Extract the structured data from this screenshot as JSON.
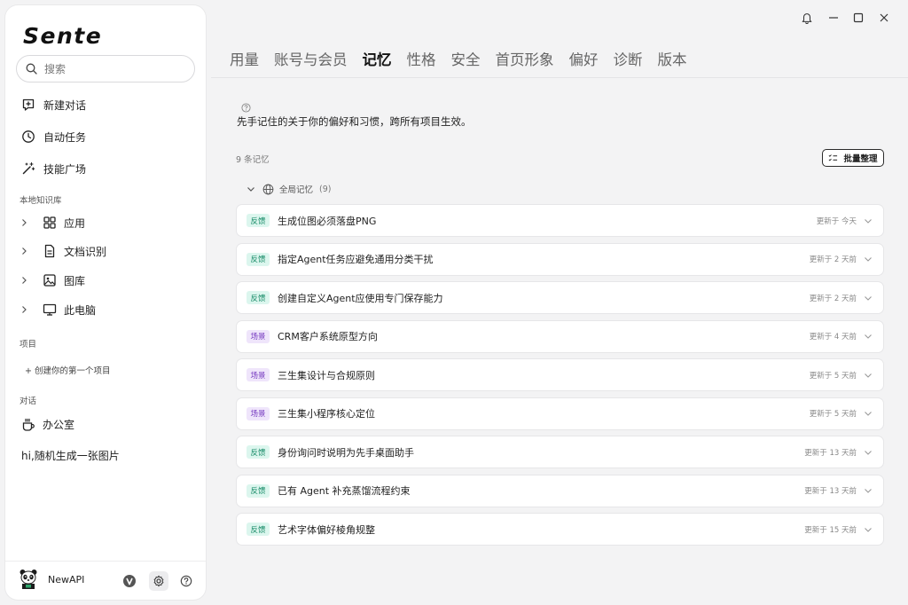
{
  "app": {
    "logo": "Sente"
  },
  "search": {
    "placeholder": "搜索"
  },
  "nav": [
    {
      "label": "新建对话",
      "icon": "new-chat-icon"
    },
    {
      "label": "自动任务",
      "icon": "clock-icon"
    },
    {
      "label": "技能广场",
      "icon": "magic-wand-icon"
    }
  ],
  "knowledge": {
    "label": "本地知识库",
    "items": [
      {
        "label": "应用",
        "icon": "apps-grid-icon"
      },
      {
        "label": "文档识别",
        "icon": "document-icon"
      },
      {
        "label": "图库",
        "icon": "image-icon"
      },
      {
        "label": "此电脑",
        "icon": "monitor-icon"
      }
    ]
  },
  "projects": {
    "label": "项目",
    "create": "+ 创建你的第一个项目"
  },
  "conversations": {
    "label": "对话",
    "items": [
      {
        "label": "办公室",
        "icon": "coffee-icon"
      },
      {
        "label": "hi,随机生成一张图片"
      }
    ]
  },
  "user": {
    "name": "NewAPI"
  },
  "tabs": [
    {
      "label": "用量",
      "active": false
    },
    {
      "label": "账号与会员",
      "active": false
    },
    {
      "label": "记忆",
      "active": true
    },
    {
      "label": "性格",
      "active": false
    },
    {
      "label": "安全",
      "active": false
    },
    {
      "label": "首页形象",
      "active": false
    },
    {
      "label": "偏好",
      "active": false
    },
    {
      "label": "诊断",
      "active": false
    },
    {
      "label": "版本",
      "active": false
    }
  ],
  "memory": {
    "description": "先手记住的关于你的偏好和习惯，跨所有项目生效。",
    "count_label": "9 条记忆",
    "batch_button": "批量整理",
    "group": {
      "label": "全局记忆",
      "count": "(9)"
    },
    "items": [
      {
        "tag": "反馈",
        "kind": "feedback",
        "title": "生成位图必须落盘PNG",
        "updated": "更新于 今天"
      },
      {
        "tag": "反馈",
        "kind": "feedback",
        "title": "指定Agent任务应避免通用分类干扰",
        "updated": "更新于 2 天前"
      },
      {
        "tag": "反馈",
        "kind": "feedback",
        "title": "创建自定义Agent应使用专门保存能力",
        "updated": "更新于 2 天前"
      },
      {
        "tag": "场景",
        "kind": "scenario",
        "title": "CRM客户系统原型方向",
        "updated": "更新于 4 天前"
      },
      {
        "tag": "场景",
        "kind": "scenario",
        "title": "三生集设计与合规原则",
        "updated": "更新于 5 天前"
      },
      {
        "tag": "场景",
        "kind": "scenario",
        "title": "三生集小程序核心定位",
        "updated": "更新于 5 天前"
      },
      {
        "tag": "反馈",
        "kind": "feedback",
        "title": "身份询问时说明为先手桌面助手",
        "updated": "更新于 13 天前"
      },
      {
        "tag": "反馈",
        "kind": "feedback",
        "title": "已有 Agent 补充蒸馏流程约束",
        "updated": "更新于 13 天前"
      },
      {
        "tag": "反馈",
        "kind": "feedback",
        "title": "艺术字体偏好棱角规整",
        "updated": "更新于 15 天前"
      }
    ]
  },
  "colors": {
    "feedback_bg": "#dcf6ee",
    "feedback_fg": "#168a66",
    "scenario_bg": "#efe5fb",
    "scenario_fg": "#7a3fc2"
  }
}
